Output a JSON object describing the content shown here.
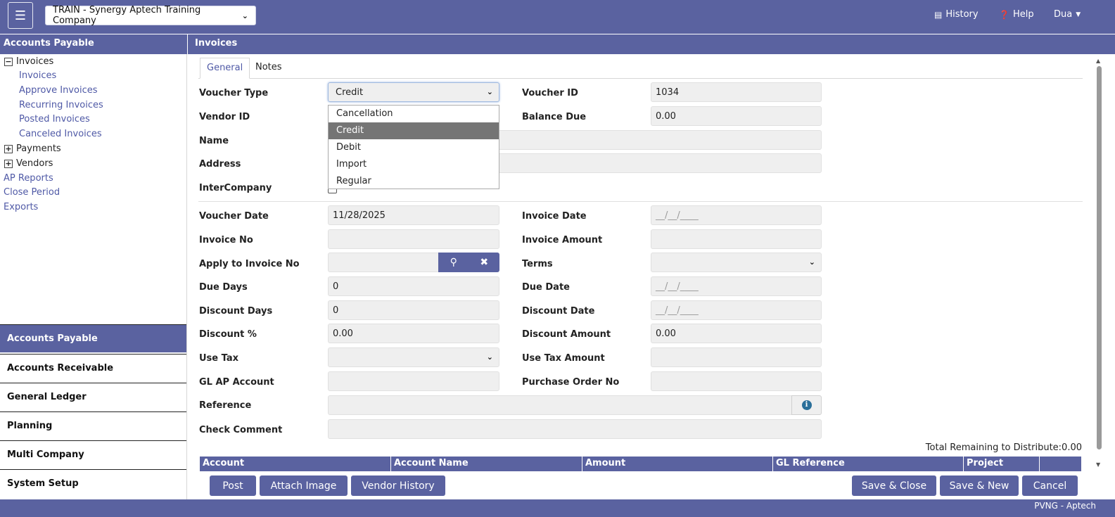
{
  "header": {
    "menu_icon": "hamburger-icon",
    "company": "TRAIN - Synergy Aptech Training Company",
    "history_label": "History",
    "help_label": "Help",
    "user_label": "Dua"
  },
  "left": {
    "title": "Accounts Payable",
    "tree": {
      "invoices": "Invoices",
      "invoices_children": [
        "Invoices",
        "Approve Invoices",
        "Recurring Invoices",
        "Posted Invoices",
        "Canceled Invoices"
      ],
      "payments": "Payments",
      "vendors": "Vendors",
      "links": [
        "AP Reports",
        "Close Period",
        "Exports"
      ]
    },
    "modules": [
      "Accounts Payable",
      "Accounts Receivable",
      "General Ledger",
      "Planning",
      "Multi Company",
      "System Setup"
    ]
  },
  "main": {
    "title": "Invoices",
    "tabs": [
      "General",
      "Notes"
    ],
    "form": {
      "voucher_type_label": "Voucher Type",
      "voucher_type_value": "Credit",
      "voucher_type_options": [
        "Cancellation",
        "Credit",
        "Debit",
        "Import",
        "Regular"
      ],
      "vendor_id_label": "Vendor ID",
      "name_label": "Name",
      "address_label": "Address",
      "intercompany_label": "InterCompany",
      "voucher_id_label": "Voucher ID",
      "voucher_id_value": "1034",
      "balance_due_label": "Balance Due",
      "balance_due_value": "0.00",
      "voucher_date_label": "Voucher Date",
      "voucher_date_value": "11/28/2025",
      "invoice_date_label": "Invoice Date",
      "invoice_date_value": "__/__/____",
      "invoice_no_label": "Invoice No",
      "invoice_amount_label": "Invoice Amount",
      "apply_invoice_label": "Apply to Invoice No",
      "terms_label": "Terms",
      "due_days_label": "Due Days",
      "due_days_value": "0",
      "due_date_label": "Due Date",
      "due_date_value": "__/__/____",
      "discount_days_label": "Discount Days",
      "discount_days_value": "0",
      "discount_date_label": "Discount Date",
      "discount_date_value": "__/__/____",
      "discount_pct_label": "Discount %",
      "discount_pct_value": "0.00",
      "discount_amount_label": "Discount Amount",
      "discount_amount_value": "0.00",
      "use_tax_label": "Use Tax",
      "use_tax_amount_label": "Use Tax Amount",
      "gl_ap_label": "GL AP Account",
      "po_label": "Purchase Order No",
      "reference_label": "Reference",
      "check_comment_label": "Check Comment"
    },
    "total_remaining": "Total Remaining to Distribute:0.00",
    "grid_columns": [
      "Account",
      "Account Name",
      "Amount",
      "GL Reference",
      "Project"
    ],
    "buttons": {
      "post": "Post",
      "attach": "Attach Image",
      "vendor_history": "Vendor History",
      "save_close": "Save & Close",
      "save_new": "Save & New",
      "cancel": "Cancel"
    }
  },
  "footer": {
    "text": "PVNG - Aptech"
  }
}
